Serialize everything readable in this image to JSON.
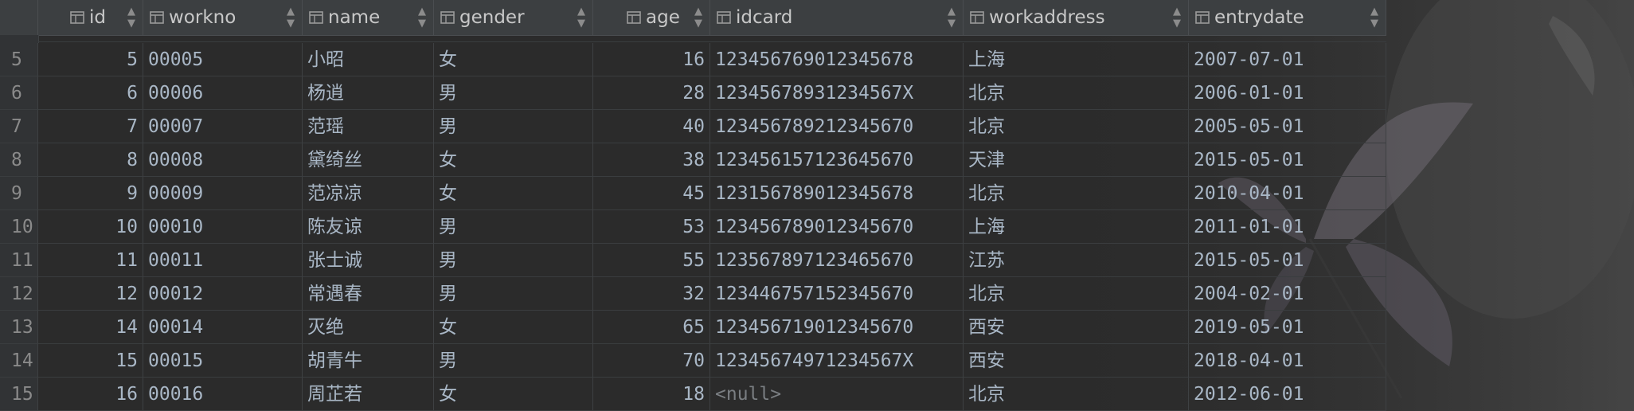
{
  "table": {
    "columns": [
      {
        "key": "id",
        "label": "id"
      },
      {
        "key": "workno",
        "label": "workno"
      },
      {
        "key": "name",
        "label": "name"
      },
      {
        "key": "gender",
        "label": "gender"
      },
      {
        "key": "age",
        "label": "age"
      },
      {
        "key": "idcard",
        "label": "idcard"
      },
      {
        "key": "workaddress",
        "label": "workaddress"
      },
      {
        "key": "entrydate",
        "label": "entrydate"
      }
    ],
    "partial_row_hint": "(partially scrolled row above)",
    "rows": [
      {
        "rownum": "5",
        "id": "5",
        "workno": "00005",
        "name": "小昭",
        "gender": "女",
        "age": "16",
        "idcard": "123456769012345678",
        "workaddress": "上海",
        "entrydate": "2007-07-01"
      },
      {
        "rownum": "6",
        "id": "6",
        "workno": "00006",
        "name": "杨逍",
        "gender": "男",
        "age": "28",
        "idcard": "12345678931234567X",
        "workaddress": "北京",
        "entrydate": "2006-01-01"
      },
      {
        "rownum": "7",
        "id": "7",
        "workno": "00007",
        "name": "范瑶",
        "gender": "男",
        "age": "40",
        "idcard": "123456789212345670",
        "workaddress": "北京",
        "entrydate": "2005-05-01"
      },
      {
        "rownum": "8",
        "id": "8",
        "workno": "00008",
        "name": "黛绮丝",
        "gender": "女",
        "age": "38",
        "idcard": "123456157123645670",
        "workaddress": "天津",
        "entrydate": "2015-05-01"
      },
      {
        "rownum": "9",
        "id": "9",
        "workno": "00009",
        "name": "范凉凉",
        "gender": "女",
        "age": "45",
        "idcard": "123156789012345678",
        "workaddress": "北京",
        "entrydate": "2010-04-01"
      },
      {
        "rownum": "10",
        "id": "10",
        "workno": "00010",
        "name": "陈友谅",
        "gender": "男",
        "age": "53",
        "idcard": "123456789012345670",
        "workaddress": "上海",
        "entrydate": "2011-01-01"
      },
      {
        "rownum": "11",
        "id": "11",
        "workno": "00011",
        "name": "张士诚",
        "gender": "男",
        "age": "55",
        "idcard": "123567897123465670",
        "workaddress": "江苏",
        "entrydate": "2015-05-01"
      },
      {
        "rownum": "12",
        "id": "12",
        "workno": "00012",
        "name": "常遇春",
        "gender": "男",
        "age": "32",
        "idcard": "123446757152345670",
        "workaddress": "北京",
        "entrydate": "2004-02-01"
      },
      {
        "rownum": "13",
        "id": "14",
        "workno": "00014",
        "name": "灭绝",
        "gender": "女",
        "age": "65",
        "idcard": "123456719012345670",
        "workaddress": "西安",
        "entrydate": "2019-05-01"
      },
      {
        "rownum": "14",
        "id": "15",
        "workno": "00015",
        "name": "胡青牛",
        "gender": "男",
        "age": "70",
        "idcard": "12345674971234567X",
        "workaddress": "西安",
        "entrydate": "2018-04-01"
      },
      {
        "rownum": "15",
        "id": "16",
        "workno": "00016",
        "name": "周芷若",
        "gender": "女",
        "age": "18",
        "idcard": "<null>",
        "workaddress": "北京",
        "entrydate": "2012-06-01"
      }
    ]
  },
  "icons": {
    "column": "table-column-icon",
    "sort": "sort-arrows-icon"
  },
  "colors": {
    "background": "#2b2b2b",
    "header": "#3c3f41",
    "text": "#a9b7c6",
    "null_text": "#7a7e82"
  }
}
